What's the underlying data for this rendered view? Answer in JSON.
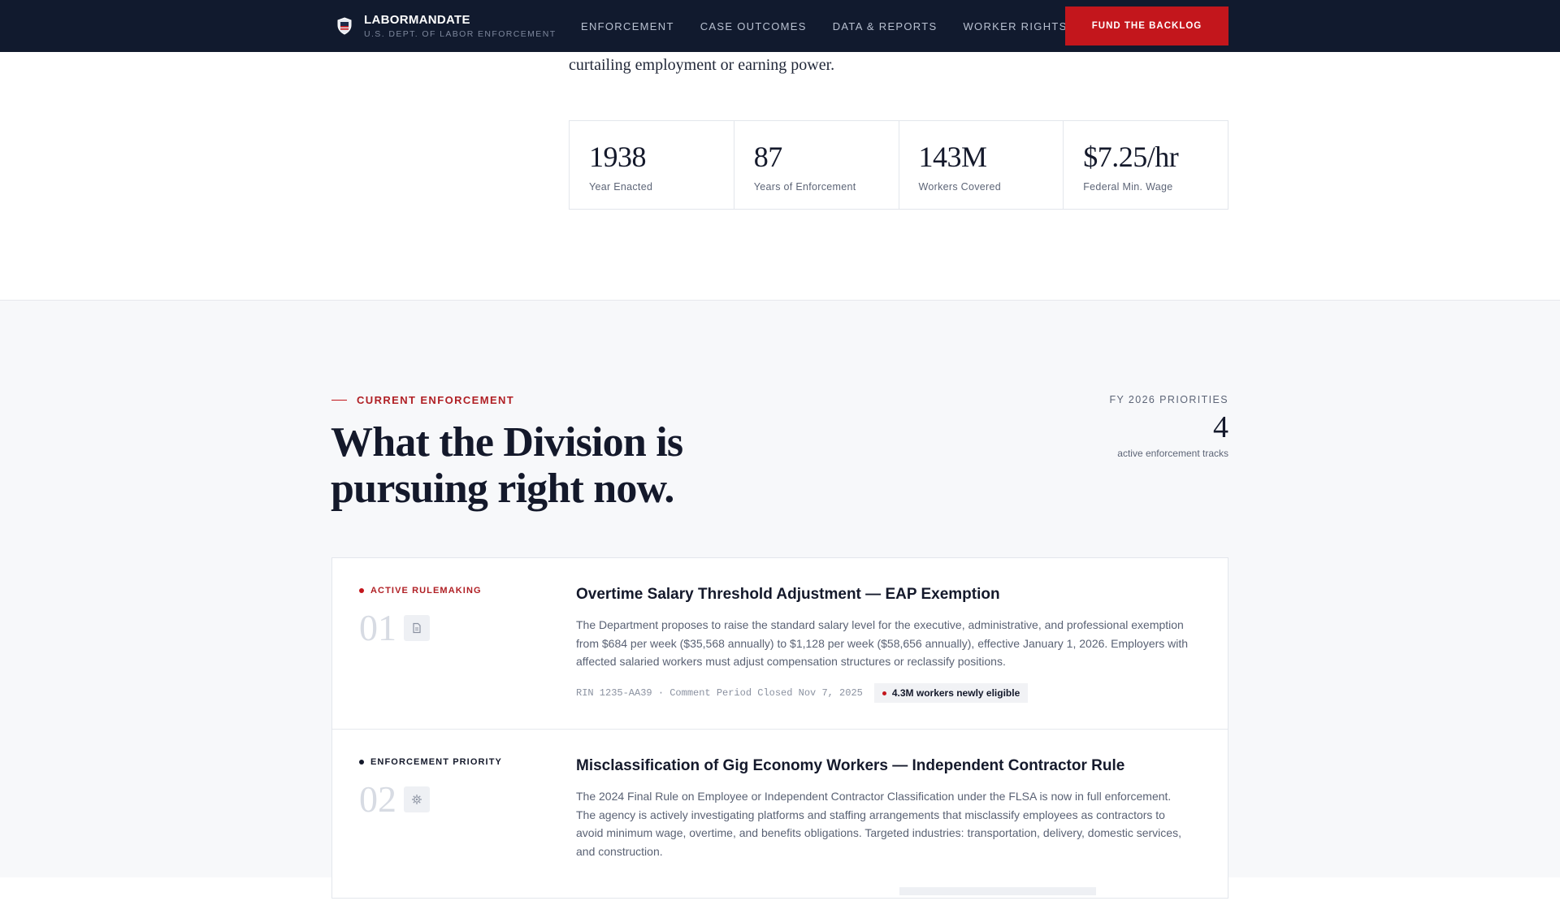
{
  "nav": {
    "brand_name": "LABORMANDATE",
    "brand_sub": "U.S. DEPT. OF LABOR ENFORCEMENT",
    "links": [
      "ENFORCEMENT",
      "CASE OUTCOMES",
      "DATA & REPORTS",
      "WORKER RIGHTS"
    ],
    "cta": "FUND THE BACKLOG",
    "logo_icon": "shield-icon"
  },
  "intro": {
    "text": "curtailing employment or earning power."
  },
  "stats": [
    {
      "value": "1938",
      "label": "Year Enacted"
    },
    {
      "value": "87",
      "label": "Years of Enforcement"
    },
    {
      "value": "143M",
      "label": "Workers Covered"
    },
    {
      "value": "$7.25/hr",
      "label": "Federal Min. Wage"
    }
  ],
  "enforcement": {
    "eyebrow": "CURRENT ENFORCEMENT",
    "headline": "What the Division is pursuing right now.",
    "priorities_label": "FY 2026 PRIORITIES",
    "priorities_count": "4",
    "priorities_sub": "active enforcement tracks"
  },
  "cards": [
    {
      "tag": "ACTIVE RULEMAKING",
      "tag_color": "#b01f24",
      "number": "01",
      "icon": "document-icon",
      "title": "Overtime Salary Threshold Adjustment — EAP Exemption",
      "description": "The Department proposes to raise the standard salary level for the executive, administrative, and professional exemption from $684 per week ($35,568 annually) to $1,128 per week ($58,656 annually), effective January 1, 2026. Employers with affected salaried workers must adjust compensation structures or reclassify positions.",
      "meta": "RIN 1235-AA39 · Comment Period Closed Nov 7, 2025",
      "badge": "4.3M workers newly eligible"
    },
    {
      "tag": "ENFORCEMENT PRIORITY",
      "tag_color": "#14192b",
      "number": "02",
      "icon": "gear-icon",
      "title": "Misclassification of Gig Economy Workers — Independent Contractor Rule",
      "description": "The 2024 Final Rule on Employee or Independent Contractor Classification under the FLSA is now in full enforcement. The agency is actively investigating platforms and staffing arrangements that misclassify employees as contractors to avoid minimum wage, overtime, and benefits obligations. Targeted industries: transportation, delivery, domestic services, and construction."
    }
  ]
}
